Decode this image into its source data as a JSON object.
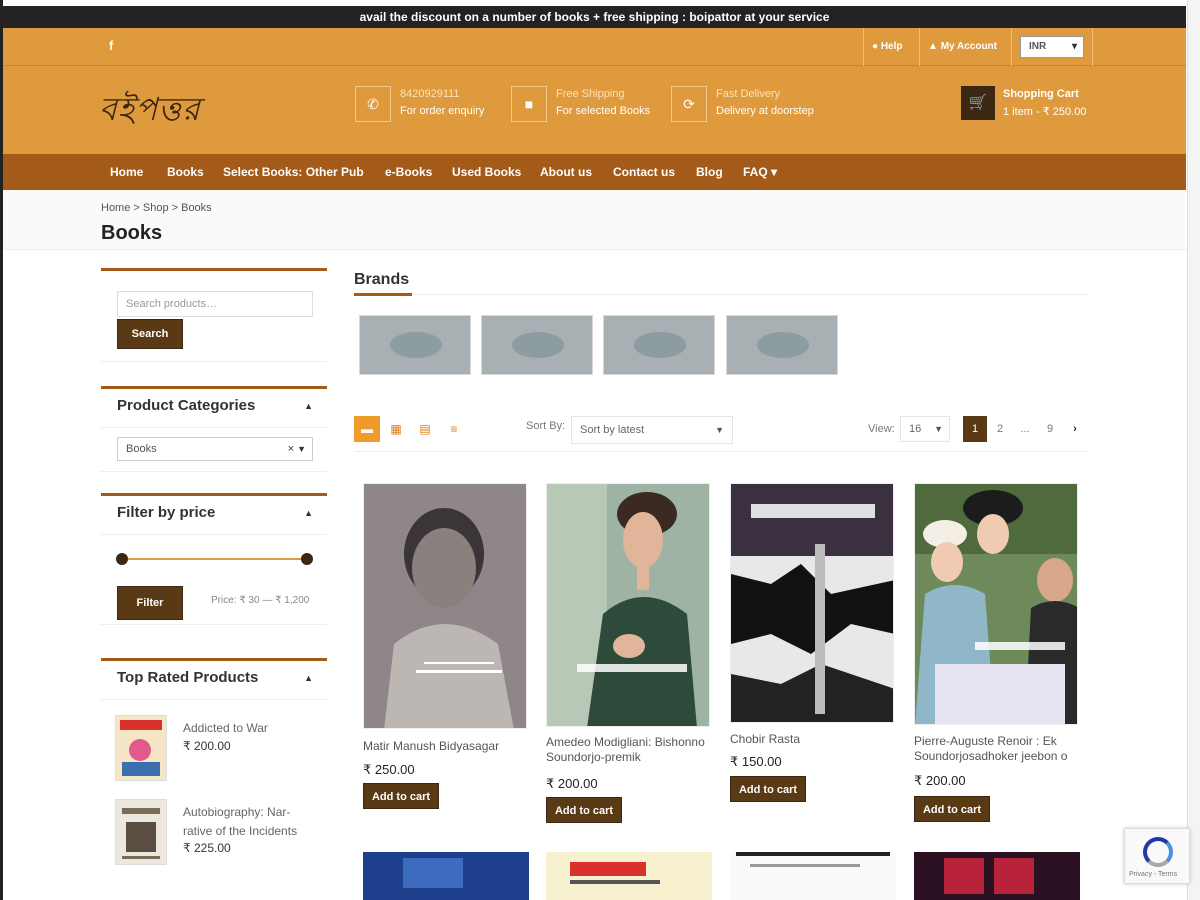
{
  "announcement": "avail the discount on a number of books + free shipping : boipattor at your service",
  "topbar": {
    "help_label": "Help",
    "account_label": "My Account",
    "currency_value": "INR"
  },
  "header": {
    "logo_text": "বইপত্তর",
    "phone": {
      "line1": "8420929111",
      "line2": "For order enquiry"
    },
    "shipping": {
      "line1": "Free Shipping",
      "line2": "For selected Books"
    },
    "delivery": {
      "line1": "Fast Delivery",
      "line2": "Delivery at doorstep"
    },
    "cart": {
      "title": "Shopping Cart",
      "summary": "1 item - ₹ 250.00"
    }
  },
  "nav": {
    "items": [
      {
        "label": "Home"
      },
      {
        "label": "Books"
      },
      {
        "label": "Select Books: Other Pub"
      },
      {
        "label": "e-Books"
      },
      {
        "label": "Used Books"
      },
      {
        "label": "About us"
      },
      {
        "label": "Contact us"
      },
      {
        "label": "Blog"
      },
      {
        "label": "FAQ"
      }
    ]
  },
  "breadcrumb": "Home > Shop > Books",
  "page_title": "Books",
  "sidebar": {
    "search": {
      "placeholder": "Search products…",
      "button": "Search"
    },
    "categories": {
      "title": "Product Categories",
      "selected": "Books"
    },
    "price": {
      "title": "Filter by price",
      "button": "Filter",
      "range": "Price: ₹ 30 — ₹ 1,200"
    },
    "top_rated": {
      "title": "Top Rated Products",
      "items": [
        {
          "name": "Addicted to War",
          "price": "₹ 200.00"
        },
        {
          "name": "Autobiography: Nar- rative of the Incidents",
          "price": "₹ 225.00"
        }
      ]
    }
  },
  "brands": {
    "title": "Brands"
  },
  "toolbar": {
    "sort_label": "Sort By:",
    "sort_value": "Sort by latest",
    "view_label": "View:",
    "view_value": "16",
    "pages": [
      "1",
      "2",
      "...",
      "9"
    ]
  },
  "products": [
    {
      "name": "Matir Manush Bidyasagar",
      "price": "₹ 250.00",
      "add": "Add to cart"
    },
    {
      "name": "Amedeo Modigliani: Bishonno Soundorjo-premik",
      "price": "₹ 200.00",
      "add": "Add to cart"
    },
    {
      "name": "Chobir Rasta",
      "price": "₹ 150.00",
      "add": "Add to cart"
    },
    {
      "name": "Pierre-Auguste Renoir : Ek Soundorjosadhoker jeebon o",
      "price": "₹ 200.00",
      "add": "Add to cart"
    }
  ],
  "recaptcha": "Privacy - Terms",
  "colors": {
    "header_orange": "#e09a3e",
    "nav_brown": "#a45b19",
    "button_dark_brown": "#5a3a14",
    "accent_orange": "#f09a2c"
  }
}
